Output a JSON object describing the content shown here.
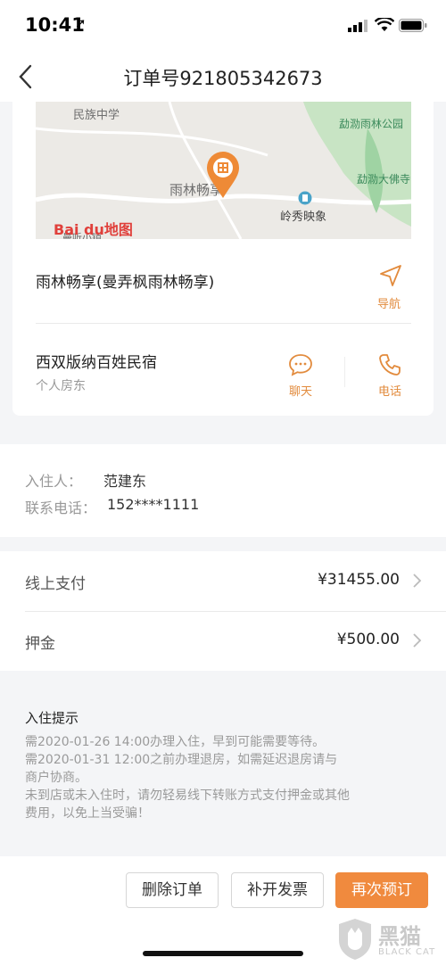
{
  "status_bar": {
    "time": "10:41"
  },
  "nav": {
    "title": "订单号921805342673"
  },
  "map": {
    "labels": [
      "民族中学",
      "雨林畅享",
      "岭秀映象",
      "勐泐雨林公园",
      "勐泐大佛寺",
      "曼听小镇"
    ],
    "baidu_logo": "Bai du地图"
  },
  "location": {
    "poi_name": "雨林畅享(曼弄枫雨林畅享)",
    "navigate_label": "导航"
  },
  "host": {
    "name": "西双版纳百姓民宿",
    "type": "个人房东",
    "chat_label": "聊天",
    "phone_label": "电话"
  },
  "guest": {
    "name_label": "入住人：",
    "name_value": "范建东",
    "phone_label": "联系电话：",
    "phone_value": "152****1111"
  },
  "payments": [
    {
      "label": "线上支付",
      "amount": "¥31455.00"
    },
    {
      "label": "押金",
      "amount": "¥500.00"
    }
  ],
  "notice": {
    "title": "入住提示",
    "lines": [
      "需2020-01-26  14:00办理入住，早到可能需要等待。",
      "需2020-01-31  12:00之前办理退房，如需延迟退房请与",
      "商户协商。",
      "未到店或未入住时，请勿轻易线下转账方式支付押金或其他",
      "费用，以免上当受骗！"
    ]
  },
  "actions": {
    "delete": "删除订单",
    "invoice": "补开发票",
    "rebook": "再次预订"
  },
  "watermark": {
    "text": "黑猫",
    "sub": "BLACK CAT"
  },
  "colors": {
    "accent": "#f08a3e",
    "accent_text": "#e28b3d"
  }
}
